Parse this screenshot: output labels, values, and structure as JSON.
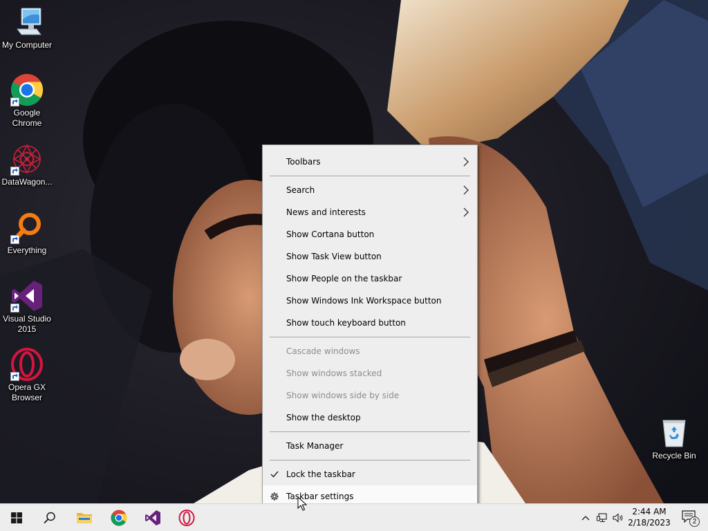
{
  "desktop": {
    "icons": [
      {
        "label": "My Computer",
        "icon": "computer-icon"
      },
      {
        "label": "Google Chrome",
        "icon": "chrome-icon"
      },
      {
        "label": "DataWagon...",
        "icon": "datawagon-icon"
      },
      {
        "label": "Everything",
        "icon": "everything-search-icon"
      },
      {
        "label": "Visual Studio 2015",
        "icon": "visual-studio-icon"
      },
      {
        "label": "Opera GX Browser",
        "icon": "opera-gx-icon"
      },
      {
        "label": "Recycle Bin",
        "icon": "recycle-bin-icon"
      }
    ]
  },
  "context_menu": {
    "items": [
      {
        "label": "Toolbars",
        "submenu": true
      },
      {
        "label": "Search",
        "submenu": true
      },
      {
        "label": "News and interests",
        "submenu": true
      },
      {
        "label": "Show Cortana button"
      },
      {
        "label": "Show Task View button"
      },
      {
        "label": "Show People on the taskbar"
      },
      {
        "label": "Show Windows Ink Workspace button"
      },
      {
        "label": "Show touch keyboard button"
      },
      {
        "label": "Cascade windows",
        "disabled": true
      },
      {
        "label": "Show windows stacked",
        "disabled": true
      },
      {
        "label": "Show windows side by side",
        "disabled": true
      },
      {
        "label": "Show the desktop"
      },
      {
        "label": "Task Manager"
      },
      {
        "label": "Lock the taskbar",
        "checked": true
      },
      {
        "label": "Taskbar settings",
        "icon": "gear-icon",
        "hovered": true
      }
    ]
  },
  "taskbar": {
    "pinned": [
      "start-button",
      "search-button",
      "file-explorer",
      "google-chrome",
      "visual-studio",
      "opera-gx"
    ],
    "tray": [
      "chevron-up-icon",
      "network-icon",
      "volume-icon"
    ],
    "clock_time": "2:44 AM",
    "clock_date": "2/18/2023",
    "notification_count": "2"
  },
  "colors": {
    "menu_bg": "#eeeeee",
    "menu_disabled_text": "#8d8d8d",
    "taskbar_bg": "#ededed",
    "vs_purple": "#68217a",
    "opera_red": "#d3163f",
    "chrome_blue": "#1a73e8"
  }
}
